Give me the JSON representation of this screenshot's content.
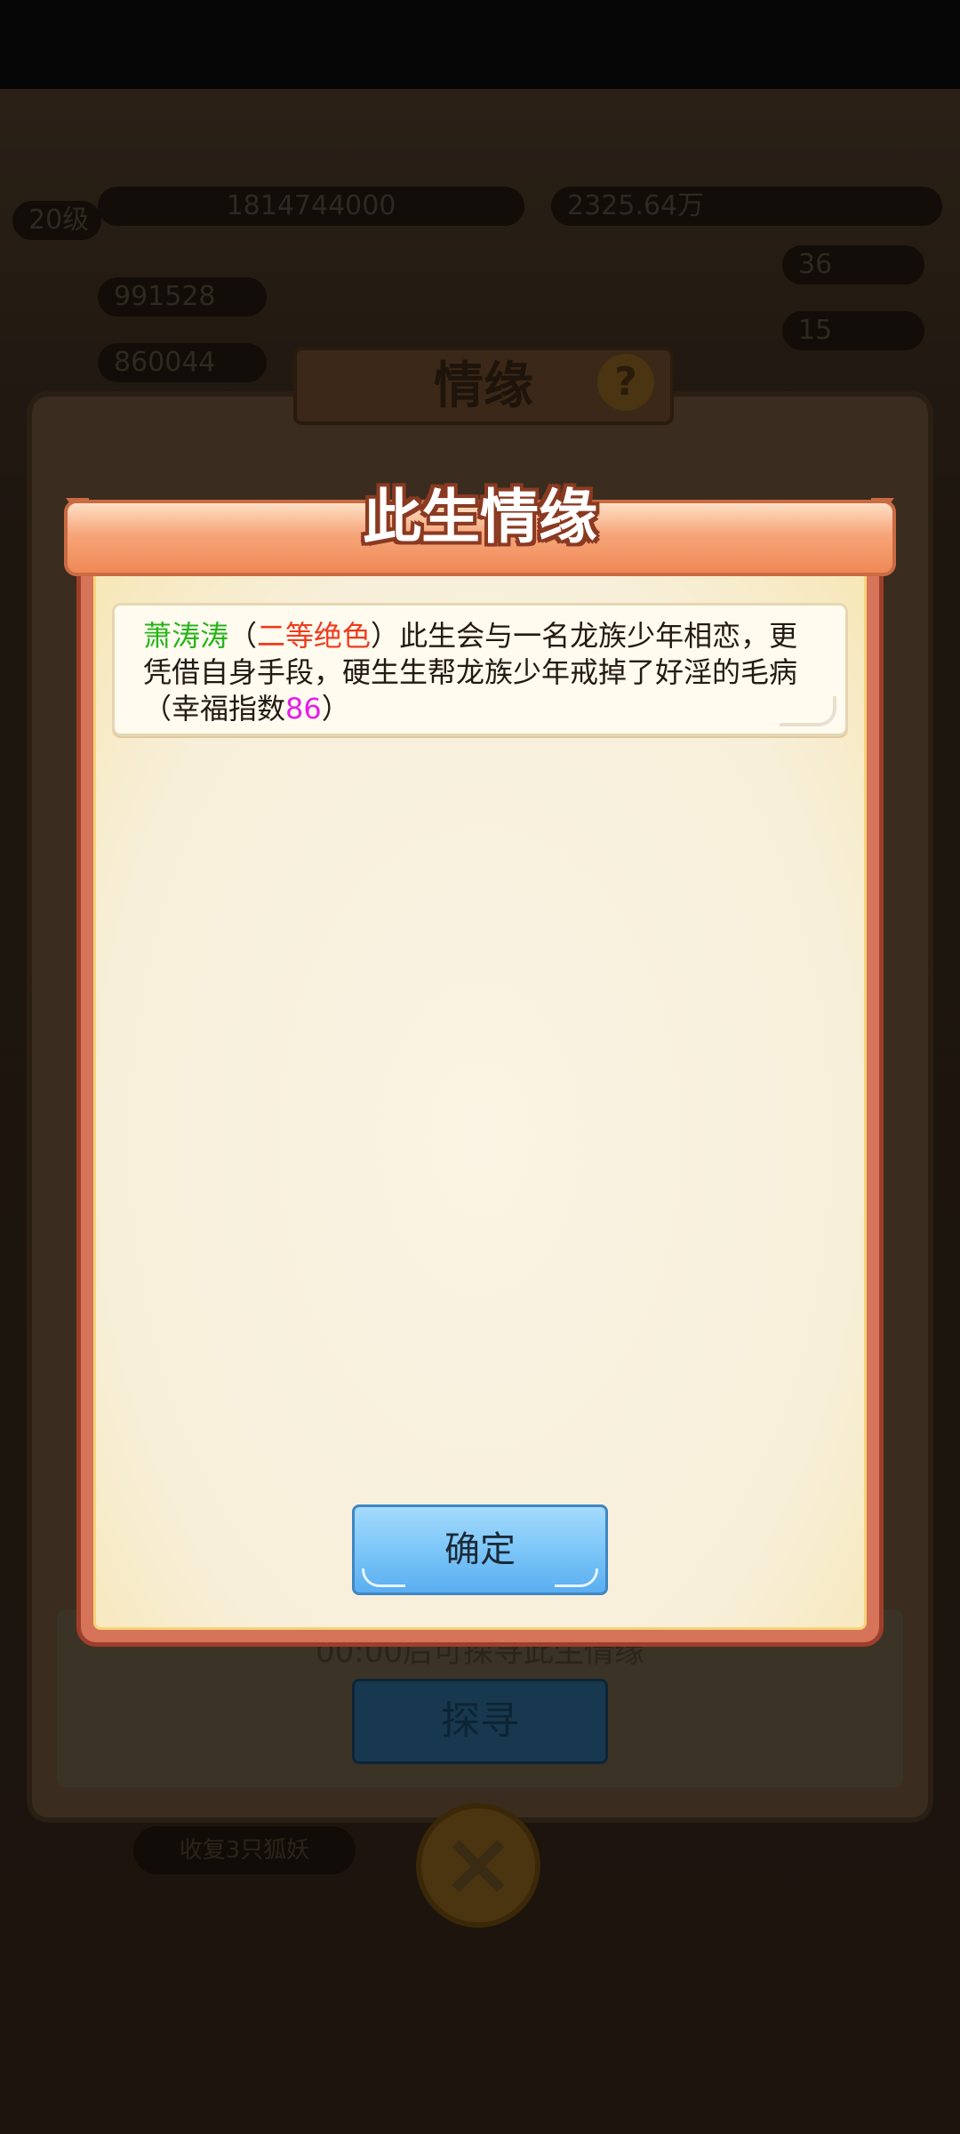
{
  "background": {
    "hud": {
      "level": "20级",
      "power": "1814744000",
      "currency": "2325.64万",
      "stat1_value": "991528",
      "stat2_value": "860044",
      "right_stat1": "36",
      "right_stat2": "15"
    },
    "panel_title": "情缘",
    "help_icon": "question-icon",
    "countdown_text": "00:00后可探寻此生情缘",
    "search_button": "探寻",
    "bottom_pill": "收复3只狐妖"
  },
  "popup": {
    "title": "此生情缘",
    "message": {
      "name": "萧涛涛",
      "open_paren": "（",
      "rank": "二等绝色",
      "close_paren": "）",
      "body": "此生会与一名龙族少年相恋，更凭借自身手段，硬生生帮龙族少年戒掉了好淫的毛病（幸福指数",
      "score": "86",
      "end": "）"
    },
    "confirm_label": "确定"
  },
  "colors": {
    "name": "#27b51a",
    "rank": "#ef3a1e",
    "score": "#e51fe8",
    "confirm_button": "#7cc6f8",
    "popup_border": "#d6745a"
  }
}
